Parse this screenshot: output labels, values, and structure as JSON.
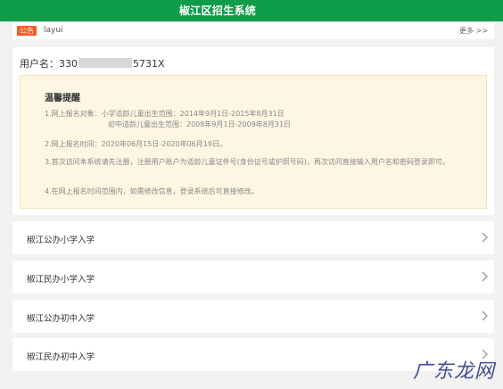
{
  "header": {
    "title": "椒江区招生系统",
    "bg_color": "#0f9d4a"
  },
  "notice": {
    "badge": "公告",
    "badge_color": "#ff5722",
    "text": "layui",
    "more": "更多 >>"
  },
  "user": {
    "label": "用户名：",
    "prefix": "330",
    "suffix": "5731X"
  },
  "tips": {
    "title": "温馨提醒",
    "line1a": "1.网上报名对象：小学适龄儿童出生范围：2014年9月1日-2015年8月31日",
    "line1b": "初中适龄儿童出生范围：2008年9月1日-2009年8月31日",
    "line2": "2.网上报名时间：2020年06月15日-2020年06月19日。",
    "line3": "3.首次访问本系统请先注册，注册用户账户为适龄儿童证件号(身份证号或护照号码)，再次访问直接输入用户名和密码登录即可。",
    "line4": "4.在网上报名时间范围内，如需修改信息，登录系统后可直接修改。"
  },
  "menu": [
    {
      "label": "椒江公办小学入学"
    },
    {
      "label": "椒江民办小学入学"
    },
    {
      "label": "椒江公办初中入学"
    },
    {
      "label": "椒江民办初中入学"
    }
  ],
  "watermark": {
    "text": "广东龙网"
  }
}
